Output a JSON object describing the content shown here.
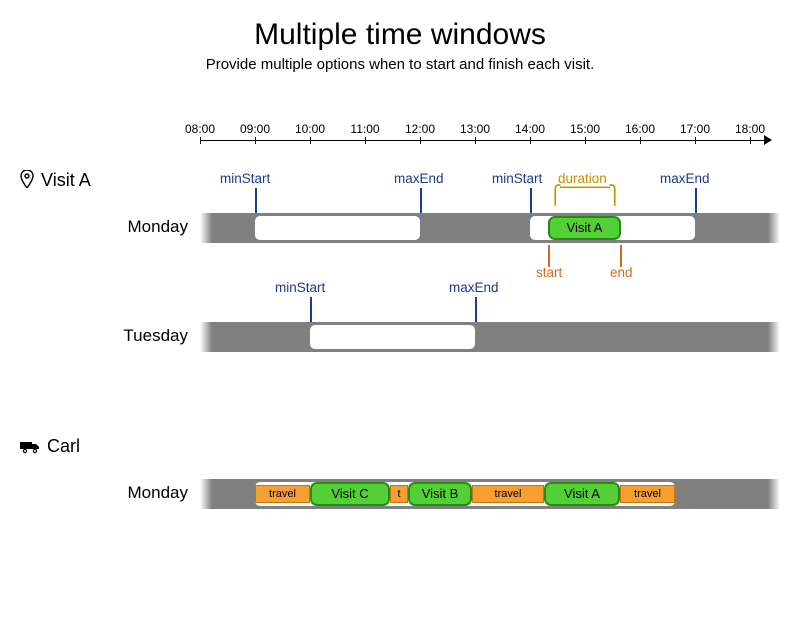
{
  "title": "Multiple time windows",
  "subtitle": "Provide multiple options when to start and finish each visit.",
  "axis": {
    "start": "08:00",
    "ticks": [
      "08:00",
      "09:00",
      "10:00",
      "11:00",
      "12:00",
      "13:00",
      "14:00",
      "15:00",
      "16:00",
      "17:00",
      "18:00"
    ]
  },
  "visitA": {
    "label": "Visit A",
    "rows": [
      {
        "day": "Monday",
        "windows": [
          {
            "minStart": "09:00",
            "maxEnd": "12:00"
          },
          {
            "minStart": "14:00",
            "maxEnd": "17:00"
          }
        ],
        "visit": {
          "label": "Visit A",
          "start": "14:20",
          "end": "15:40",
          "duration_label": "duration",
          "start_label": "start",
          "end_label": "end"
        }
      },
      {
        "day": "Tuesday",
        "windows": [
          {
            "minStart": "10:00",
            "maxEnd": "13:00"
          }
        ]
      }
    ]
  },
  "carl": {
    "label": "Carl",
    "day": "Monday",
    "segments": [
      {
        "type": "travel",
        "label": "travel"
      },
      {
        "type": "visit",
        "label": "Visit C"
      },
      {
        "type": "travel",
        "label": "t"
      },
      {
        "type": "visit",
        "label": "Visit B"
      },
      {
        "type": "travel",
        "label": "travel"
      },
      {
        "type": "visit",
        "label": "Visit A"
      },
      {
        "type": "travel",
        "label": "travel"
      }
    ]
  },
  "annotations": {
    "minStart": "minStart",
    "maxEnd": "maxEnd"
  },
  "chart_data": {
    "type": "gantt",
    "time_axis": {
      "from": "08:00",
      "to": "18:00",
      "major_tick_hours": 1
    },
    "resources": [
      {
        "name": "Visit A",
        "days": [
          {
            "day": "Monday",
            "time_windows": [
              [
                "09:00",
                "12:00"
              ],
              [
                "14:00",
                "17:00"
              ]
            ],
            "scheduled": {
              "label": "Visit A",
              "start": "14:20",
              "end": "15:40"
            }
          },
          {
            "day": "Tuesday",
            "time_windows": [
              [
                "10:00",
                "13:00"
              ]
            ]
          }
        ]
      },
      {
        "name": "Carl",
        "days": [
          {
            "day": "Monday",
            "sequence": [
              {
                "type": "travel",
                "from": "09:00",
                "to": "10:00"
              },
              {
                "type": "visit",
                "label": "Visit C",
                "from": "10:00",
                "to": "11:30"
              },
              {
                "type": "travel",
                "from": "11:30",
                "to": "11:50"
              },
              {
                "type": "visit",
                "label": "Visit B",
                "from": "11:50",
                "to": "13:00"
              },
              {
                "type": "travel",
                "from": "13:00",
                "to": "14:20"
              },
              {
                "type": "visit",
                "label": "Visit A",
                "from": "14:20",
                "to": "15:40"
              },
              {
                "type": "travel",
                "from": "15:40",
                "to": "16:40"
              }
            ]
          }
        ]
      }
    ]
  }
}
